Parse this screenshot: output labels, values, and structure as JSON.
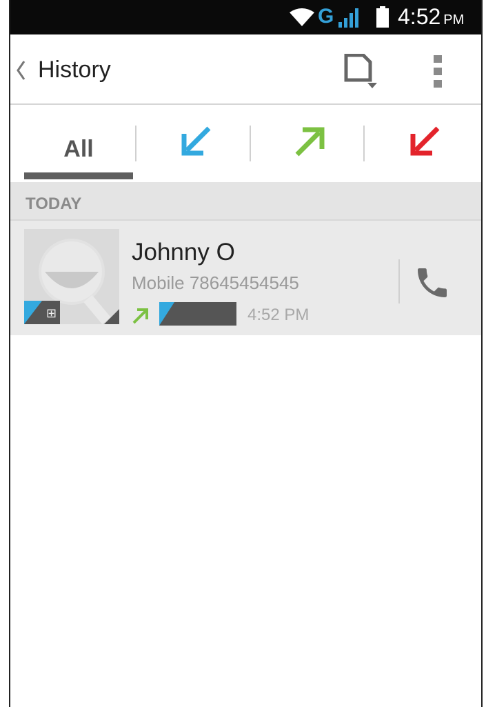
{
  "status_bar": {
    "network": "G",
    "time": "4:52",
    "ampm": "PM",
    "icons": [
      "wifi-icon",
      "signal-icon",
      "battery-icon"
    ]
  },
  "header": {
    "title": "History",
    "icons": [
      "back-chevron-icon",
      "sim-card-icon",
      "overflow-menu-icon"
    ]
  },
  "tabs": [
    {
      "label": "All",
      "selected": true
    },
    {
      "icon": "incoming-call-icon",
      "color": "#33a9df"
    },
    {
      "icon": "outgoing-call-icon",
      "color": "#7cc142"
    },
    {
      "icon": "missed-call-icon",
      "color": "#e3232b"
    }
  ],
  "section": {
    "header": "TODAY"
  },
  "calls": [
    {
      "name": "Johnny O",
      "number": "Mobile 78645454545",
      "time": "4:52 PM",
      "type": "outgoing",
      "sim_badge": "⊞"
    }
  ],
  "colors": {
    "incoming": "#33a9df",
    "outgoing": "#7cc142",
    "missed": "#e3232b",
    "sim_accent": "#33a9df"
  }
}
